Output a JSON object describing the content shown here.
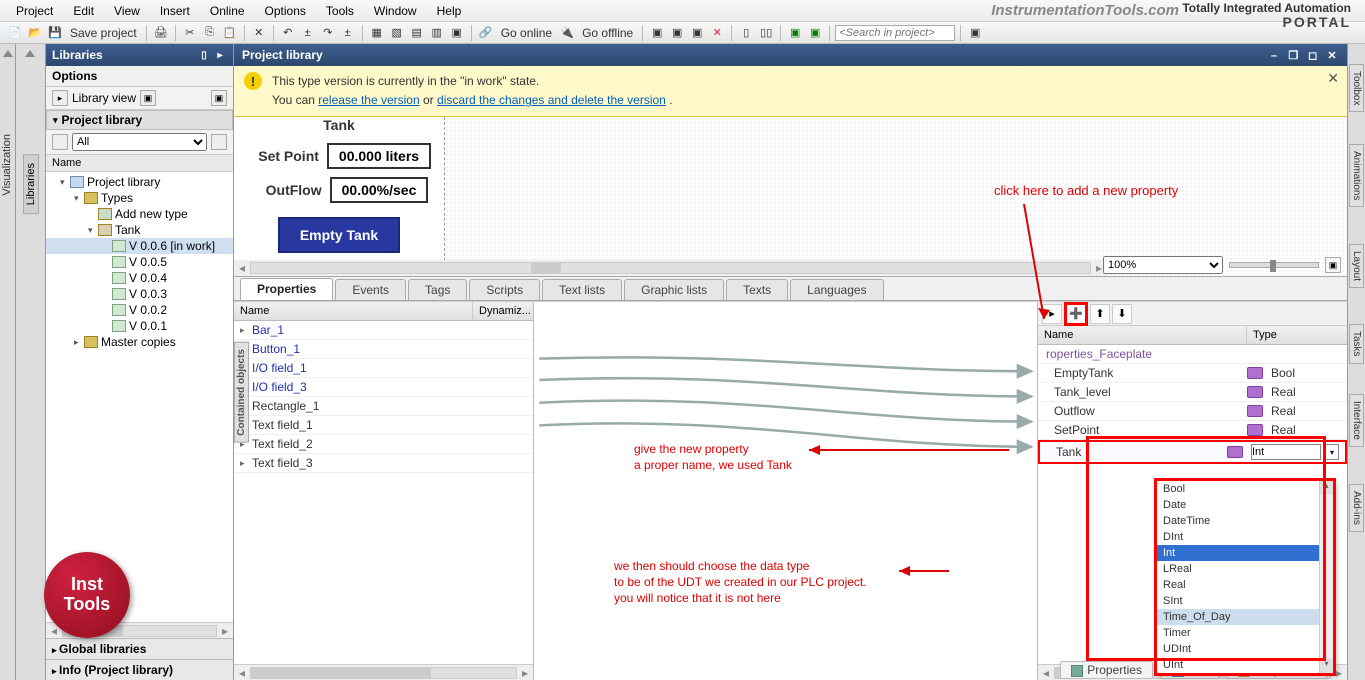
{
  "menu": {
    "items": [
      "Project",
      "Edit",
      "View",
      "Insert",
      "Online",
      "Options",
      "Tools",
      "Window",
      "Help"
    ]
  },
  "brand": "InstrumentationTools.com",
  "tia": {
    "line1": "Totally Integrated Automation",
    "line2": "PORTAL"
  },
  "toolbar": {
    "save_label": "Save project",
    "go_online": "Go online",
    "go_offline": "Go offline",
    "search_placeholder": "<Search in project>"
  },
  "left_vtabs": {
    "visualization": "Visualization",
    "libraries": "Libraries"
  },
  "libraries_panel": {
    "title": "Libraries",
    "options": "Options",
    "library_view": "Library view",
    "project_library": "Project library",
    "filter_all": "All",
    "name_col": "Name",
    "tree": {
      "project_library": "Project library",
      "types": "Types",
      "add_new_type": "Add new type",
      "tank": "Tank",
      "versions": [
        "V 0.0.6 [in work]",
        "V 0.0.5",
        "V 0.0.4",
        "V 0.0.3",
        "V 0.0.2",
        "V 0.0.1"
      ],
      "master_copies": "Master copies"
    },
    "global_libraries": "Global libraries",
    "info": "Info (Project library)"
  },
  "editor": {
    "title": "Project library",
    "banner": {
      "line1": "This type version is currently in the \"in work\" state.",
      "line2_pre": "You can ",
      "link_release": "release the version",
      "mid": "  or ",
      "link_discard": "discard the changes and delete the version",
      "suffix": " ."
    },
    "faceplate": {
      "title": "Tank",
      "setpoint_label": "Set Point",
      "setpoint_value": "00.000 liters",
      "outflow_label": "OutFlow",
      "outflow_value": "00.00%/sec",
      "empty_btn": "Empty Tank"
    },
    "zoom": "100%",
    "tabs": [
      "Properties",
      "Events",
      "Tags",
      "Scripts",
      "Text lists",
      "Graphic lists",
      "Texts",
      "Languages"
    ],
    "contained_objects_label": "Contained objects",
    "contained_objects": {
      "cols": {
        "name": "Name",
        "dynamiz": "Dynamiz..."
      },
      "rows": [
        "Bar_1",
        "Button_1",
        "I/O field_1",
        "I/O field_3",
        "Rectangle_1",
        "Text field_1",
        "Text field_2",
        "Text field_3"
      ]
    },
    "interface": {
      "cols": {
        "name": "Name",
        "type": "Type"
      },
      "root": "roperties_Faceplate",
      "rows": [
        {
          "name": "EmptyTank",
          "type": "Bool"
        },
        {
          "name": "Tank_level",
          "type": "Real"
        },
        {
          "name": "Outflow",
          "type": "Real"
        },
        {
          "name": "SetPoint",
          "type": "Real"
        },
        {
          "name": "Tank",
          "type": "Int"
        }
      ]
    },
    "type_options": [
      "Bool",
      "Date",
      "DateTime",
      "DInt",
      "Int",
      "LReal",
      "Real",
      "SInt",
      "Time_Of_Day",
      "Timer",
      "UDInt",
      "UInt"
    ],
    "type_selected": "Int",
    "type_hover": "Time_Of_Day"
  },
  "footer": {
    "properties": "Properties",
    "info": "Info",
    "diagnostics": "Diagnostics"
  },
  "right_vtabs": [
    "Toolbox",
    "Animations",
    "Layout",
    "Tasks",
    "Interface",
    "Add-ins"
  ],
  "annotations": {
    "add_prop": "click here to add a new property",
    "name_prop_1": "give the new property",
    "name_prop_2": "a proper name, we used Tank",
    "choose_1": "we then should choose the data type",
    "choose_2": "to be of the UDT we created in our PLC project.",
    "choose_3": "you will notice that it is not here"
  },
  "logo": "Inst\nTools"
}
